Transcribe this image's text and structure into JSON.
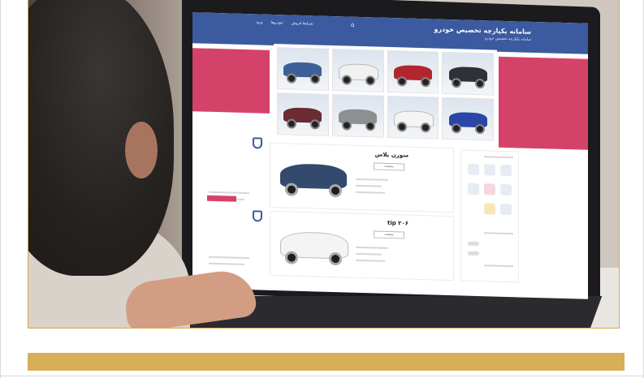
{
  "screen": {
    "header_title": "سامانه یکپارچه تخصیص خودرو",
    "header_subtitle": "سامانه یکپارچه تخصیص خودرو",
    "nav_items": [
      "شرایط فروش",
      "خودروها",
      "ورود"
    ]
  },
  "cards": [
    {
      "title": "سورن پلاس",
      "button": "مشاهده"
    },
    {
      "title": "۲۰۶ tip",
      "button": "مشاهده"
    }
  ],
  "colors": {
    "accent": "#d4426a",
    "header": "#3b5aa0",
    "gold": "#d8ae58",
    "frame": "#d9a94e"
  }
}
